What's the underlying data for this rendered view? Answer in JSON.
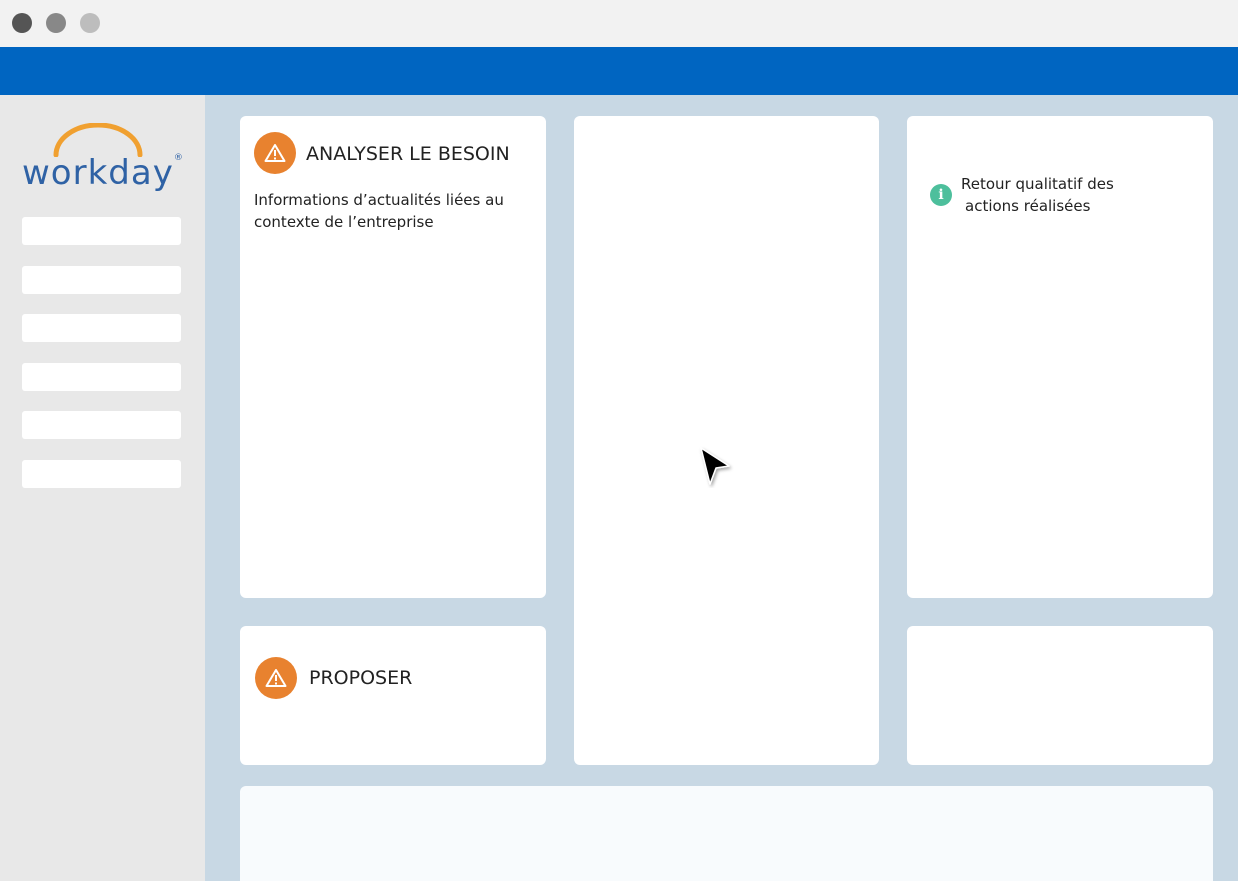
{
  "window": {
    "controls": [
      "close",
      "minimize",
      "maximize"
    ]
  },
  "sidebar": {
    "logo_text": "workday",
    "logo_mark": "®",
    "nav_item_count_visible": 6
  },
  "cards": {
    "analyser": {
      "title": "ANALYSER LE BESOIN",
      "body_line1": "Informations d’actualités liées au",
      "body_line2": "contexte de l’entreprise",
      "icon": "warning-icon"
    },
    "retour": {
      "body_line1": "Retour qualitatif des",
      "body_line2": "actions réalisées",
      "icon": "info-icon",
      "icon_glyph": "i"
    },
    "proposer": {
      "title": "PROPOSER",
      "icon": "warning-icon"
    }
  },
  "colors": {
    "header_blue": "#0065c1",
    "background": "#c8d8e4",
    "sidebar": "#e8e8e8",
    "warning_orange": "#e8822f",
    "info_green": "#4dbf9c",
    "logo_blue": "#2f62a5",
    "logo_arc": "#f0a030"
  }
}
